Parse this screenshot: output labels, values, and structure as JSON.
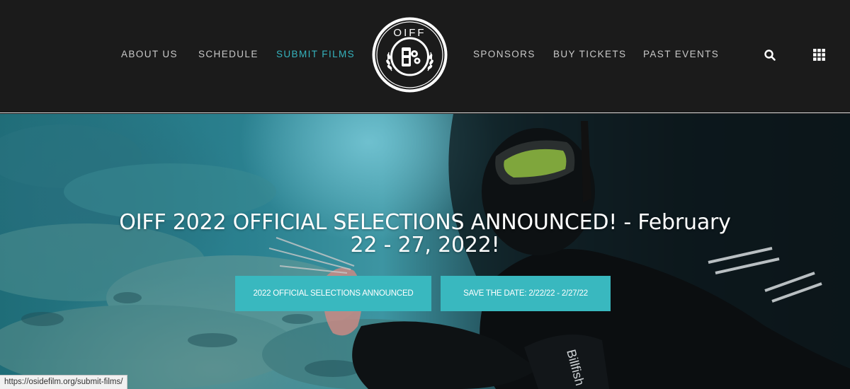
{
  "nav": {
    "left": [
      "ABOUT US",
      "SCHEDULE",
      "SUBMIT FILMS"
    ],
    "right": [
      "SPONSORS",
      "BUY TICKETS",
      "PAST EVENTS"
    ],
    "active": "SUBMIT FILMS",
    "active_color": "#35b3be"
  },
  "logo": {
    "text": "OIFF"
  },
  "icons": {
    "search": "search-icon",
    "grid": "grid-menu-icon"
  },
  "hero": {
    "title": "OIFF 2022 OFFICIAL SELECTIONS ANNOUNCED! - February 22 - 27, 2022!",
    "button_1": "2022 OFFICIAL SELECTIONS ANNOUNCED",
    "button_2": "SAVE THE DATE: 2/22/22 - 2/27/22",
    "button_color": "#39b8bf",
    "fin_brand": "Billfish"
  },
  "status_bar": {
    "url": "https://osidefilm.org/submit-films/"
  }
}
